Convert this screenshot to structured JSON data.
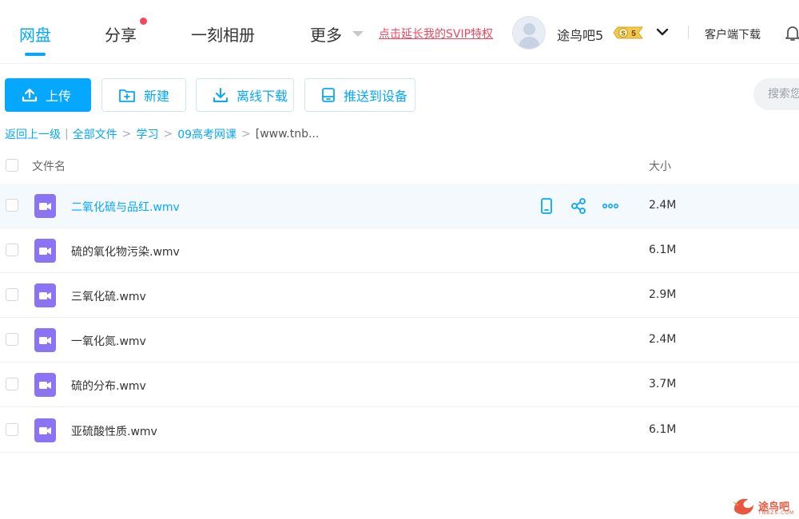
{
  "nav": {
    "tabs": [
      {
        "label": "网盘",
        "active": true
      },
      {
        "label": "分享",
        "has_dot": true
      },
      {
        "label": "一刻相册"
      },
      {
        "label": "更多"
      }
    ],
    "svip_link": "点击延长我的SVIP特权",
    "username": "途鸟吧5",
    "svip_badge": "S 5",
    "client_download": "客户端下载"
  },
  "toolbar": {
    "upload": "上传",
    "new": "新建",
    "offline_download": "离线下载",
    "push_to_device": "推送到设备",
    "search_placeholder": "搜索您"
  },
  "breadcrumb": {
    "back": "返回上一级",
    "items": [
      "全部文件",
      "学习",
      "09高考网课"
    ],
    "current": "[www.tnb..."
  },
  "table": {
    "col_name": "文件名",
    "col_size": "大小",
    "rows": [
      {
        "name": "二氧化硫与品红.wmv",
        "size": "2.4M"
      },
      {
        "name": "硫的氧化物污染.wmv",
        "size": "6.1M"
      },
      {
        "name": "三氧化硫.wmv",
        "size": "2.9M"
      },
      {
        "name": "一氧化氮.wmv",
        "size": "2.4M"
      },
      {
        "name": "硫的分布.wmv",
        "size": "3.7M"
      },
      {
        "name": "亚硫酸性质.wmv",
        "size": "6.1M"
      }
    ]
  },
  "watermark": {
    "text": "途鸟吧",
    "sub": "TNBZS.COM"
  },
  "colors": {
    "accent": "#06a7ff",
    "alert": "#f5455f",
    "video_icon": "#8b74f3"
  }
}
